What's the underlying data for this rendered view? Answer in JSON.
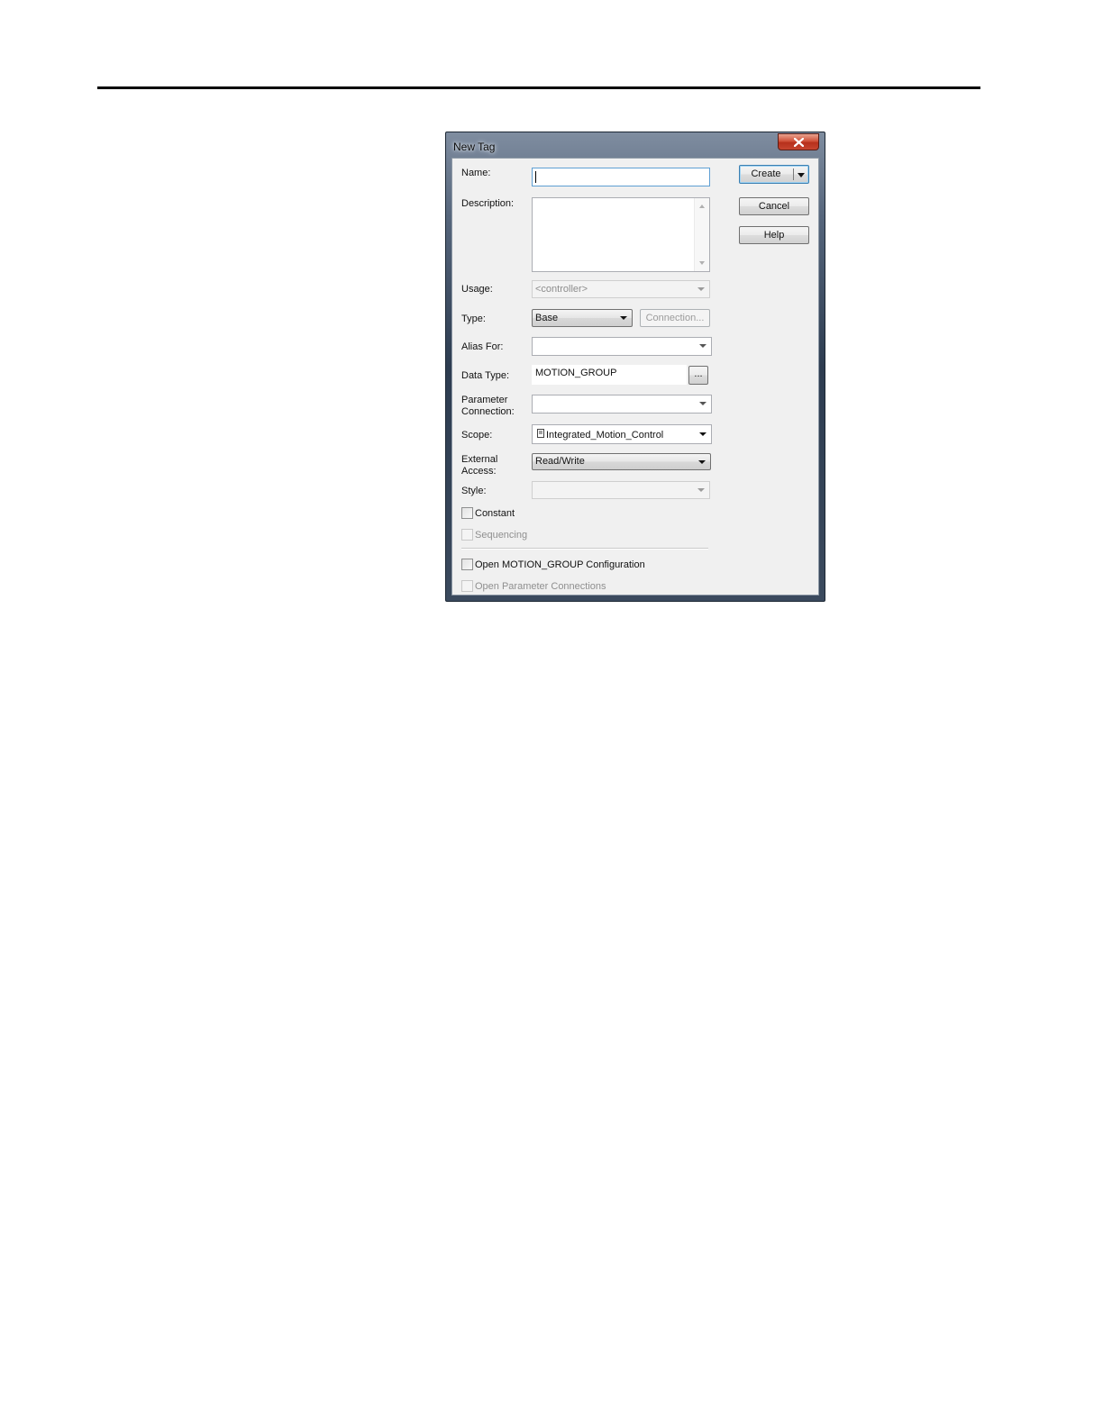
{
  "dialog": {
    "title": "New Tag",
    "close_glyph": "✕"
  },
  "fields": {
    "name_label": "Name:",
    "name_value": "",
    "description_label": "Description:",
    "description_value": "",
    "usage_label": "Usage:",
    "usage_value": "<controller>",
    "type_label": "Type:",
    "type_value": "Base",
    "alias_label": "Alias For:",
    "alias_value": "",
    "datatype_label": "Data Type:",
    "datatype_value": "MOTION_GROUP",
    "param_label_line1": "Parameter",
    "param_label_line2": "Connection:",
    "param_value": "",
    "scope_label": "Scope:",
    "scope_value": "Integrated_Motion_Control",
    "external_label_line1": "External",
    "external_label_line2": "Access:",
    "external_value": "Read/Write",
    "style_label": "Style:",
    "style_value": ""
  },
  "checkboxes": {
    "constant": "Constant",
    "sequencing": "Sequencing",
    "open_config": "Open MOTION_GROUP Configuration",
    "open_param": "Open Parameter Connections"
  },
  "buttons": {
    "create": "Create",
    "cancel": "Cancel",
    "help": "Help",
    "connection": "Connection...",
    "browse": "..."
  },
  "icons": {
    "close": "close-icon",
    "scope": "controller-scope-icon",
    "create_menu": "chevron-down-icon"
  }
}
